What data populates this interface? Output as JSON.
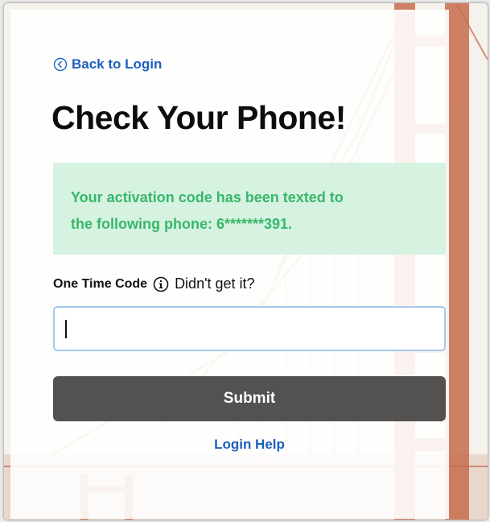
{
  "nav": {
    "back_label": "Back to Login"
  },
  "page": {
    "title": "Check Your Phone!"
  },
  "alert": {
    "line1": "Your activation code has been texted to",
    "line2": "the following phone: 6*******391."
  },
  "form": {
    "code_label": "One Time Code",
    "didnt_get_label": "Didn't get it?",
    "code_value": "",
    "submit_label": "Submit"
  },
  "footer": {
    "help_label": "Login Help"
  },
  "icons": {
    "back": "chevron-left-circle-icon",
    "info": "info-circle-icon"
  },
  "colors": {
    "link": "#1f5fbf",
    "alert_bg": "#d6f2e0",
    "alert_text": "#37b76b",
    "button": "#545250",
    "bridge": "#c86d4d"
  }
}
